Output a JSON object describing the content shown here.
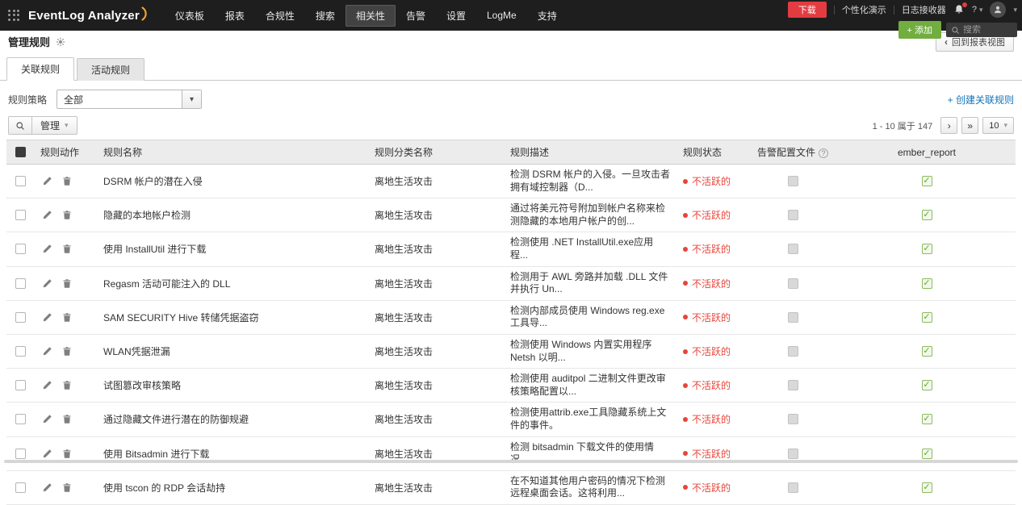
{
  "topbar": {
    "logo_text": "EventLog Analyzer",
    "nav": [
      {
        "key": "dashboard",
        "label": "仪表板",
        "active": false
      },
      {
        "key": "reports",
        "label": "报表",
        "active": false
      },
      {
        "key": "compliance",
        "label": "合规性",
        "active": false
      },
      {
        "key": "search",
        "label": "搜索",
        "active": false
      },
      {
        "key": "correlation",
        "label": "相关性",
        "active": true
      },
      {
        "key": "alerts",
        "label": "告警",
        "active": false
      },
      {
        "key": "settings",
        "label": "设置",
        "active": false
      },
      {
        "key": "logme",
        "label": "LogMe",
        "active": false
      },
      {
        "key": "support",
        "label": "支持",
        "active": false
      }
    ],
    "download_label": "下载",
    "demo_label": "个性化演示",
    "receiver_label": "日志接收器",
    "help_label": "?",
    "add_label": "+ 添加",
    "search_placeholder": "搜索"
  },
  "page_header": {
    "title": "管理规则",
    "back_label": "回到报表视图"
  },
  "tabs": [
    {
      "key": "correlation-rules",
      "label": "关联规则",
      "active": true
    },
    {
      "key": "activity-rules",
      "label": "活动规则",
      "active": false
    }
  ],
  "filters": {
    "policy_label": "规则策略",
    "policy_value": "全部",
    "create_rule_label": "+ 创建关联规则"
  },
  "toolbar": {
    "manage_label": "管理",
    "pagination_text": "1 - 10 属于 147",
    "page_size": "10"
  },
  "table": {
    "headers": {
      "actions": "规则动作",
      "name": "规则名称",
      "category": "规则分类名称",
      "description": "规则描述",
      "status": "规则状态",
      "alert_profile": "告警配置文件",
      "ember_report": "ember_report"
    },
    "rows": [
      {
        "name": "DSRM 帐户的潜在入侵",
        "category": "离地生活攻击",
        "description": "检测 DSRM 帐户的入侵。一旦攻击者拥有域控制器（D...",
        "status": "不活跃的",
        "alert_checked": false,
        "ember_checked": true
      },
      {
        "name": "隐藏的本地帐户检测",
        "category": "离地生活攻击",
        "description": "通过将美元符号附加到帐户名称来检测隐藏的本地用户帐户的创...",
        "status": "不活跃的",
        "alert_checked": false,
        "ember_checked": true
      },
      {
        "name": "使用 InstallUtil 进行下载",
        "category": "离地生活攻击",
        "description": "检测使用 .NET InstallUtil.exe应用程...",
        "status": "不活跃的",
        "alert_checked": false,
        "ember_checked": true
      },
      {
        "name": "Regasm 活动可能注入的 DLL",
        "category": "离地生活攻击",
        "description": "检测用于 AWL 旁路并加载 .DLL 文件并执行 Un...",
        "status": "不活跃的",
        "alert_checked": false,
        "ember_checked": true
      },
      {
        "name": "SAM SECURITY Hive 转储凭据盗窃",
        "category": "离地生活攻击",
        "description": "检测内部成员使用 Windows reg.exe 工具导...",
        "status": "不活跃的",
        "alert_checked": false,
        "ember_checked": true
      },
      {
        "name": "WLAN凭据泄漏",
        "category": "离地生活攻击",
        "description": "检测使用 Windows 内置实用程序 Netsh 以明...",
        "status": "不活跃的",
        "alert_checked": false,
        "ember_checked": true
      },
      {
        "name": "试图篡改审核策略",
        "category": "离地生活攻击",
        "description": "检测使用 auditpol 二进制文件更改审核策略配置以...",
        "status": "不活跃的",
        "alert_checked": false,
        "ember_checked": true
      },
      {
        "name": "通过隐藏文件进行潜在的防御规避",
        "category": "离地生活攻击",
        "description": "检测使用attrib.exe工具隐藏系统上文件的事件。",
        "status": "不活跃的",
        "alert_checked": false,
        "ember_checked": true
      },
      {
        "name": "使用 Bitsadmin 进行下载",
        "category": "离地生活攻击",
        "description": "检测 bitsadmin 下载文件的使用情况。",
        "status": "不活跃的",
        "alert_checked": false,
        "ember_checked": true
      },
      {
        "name": "使用 tscon 的 RDP 会话劫持",
        "category": "离地生活攻击",
        "description": "在不知道其他用户密码的情况下检测远程桌面会话。这将利用...",
        "status": "不活跃的",
        "alert_checked": false,
        "ember_checked": true
      }
    ]
  },
  "glyphs": {
    "caret_down": "▾",
    "chevron_left": "‹",
    "chevron_right": "›",
    "chevron_double_right": "»",
    "check": "✓",
    "help": "?"
  },
  "colors": {
    "topbar_bg": "#1e1e1e",
    "active_nav_bg": "#424242",
    "download_red": "#e23c41",
    "add_green": "#72ad40",
    "link_blue": "#1673b6",
    "status_red": "#e8443a",
    "check_green": "#6aa537"
  }
}
